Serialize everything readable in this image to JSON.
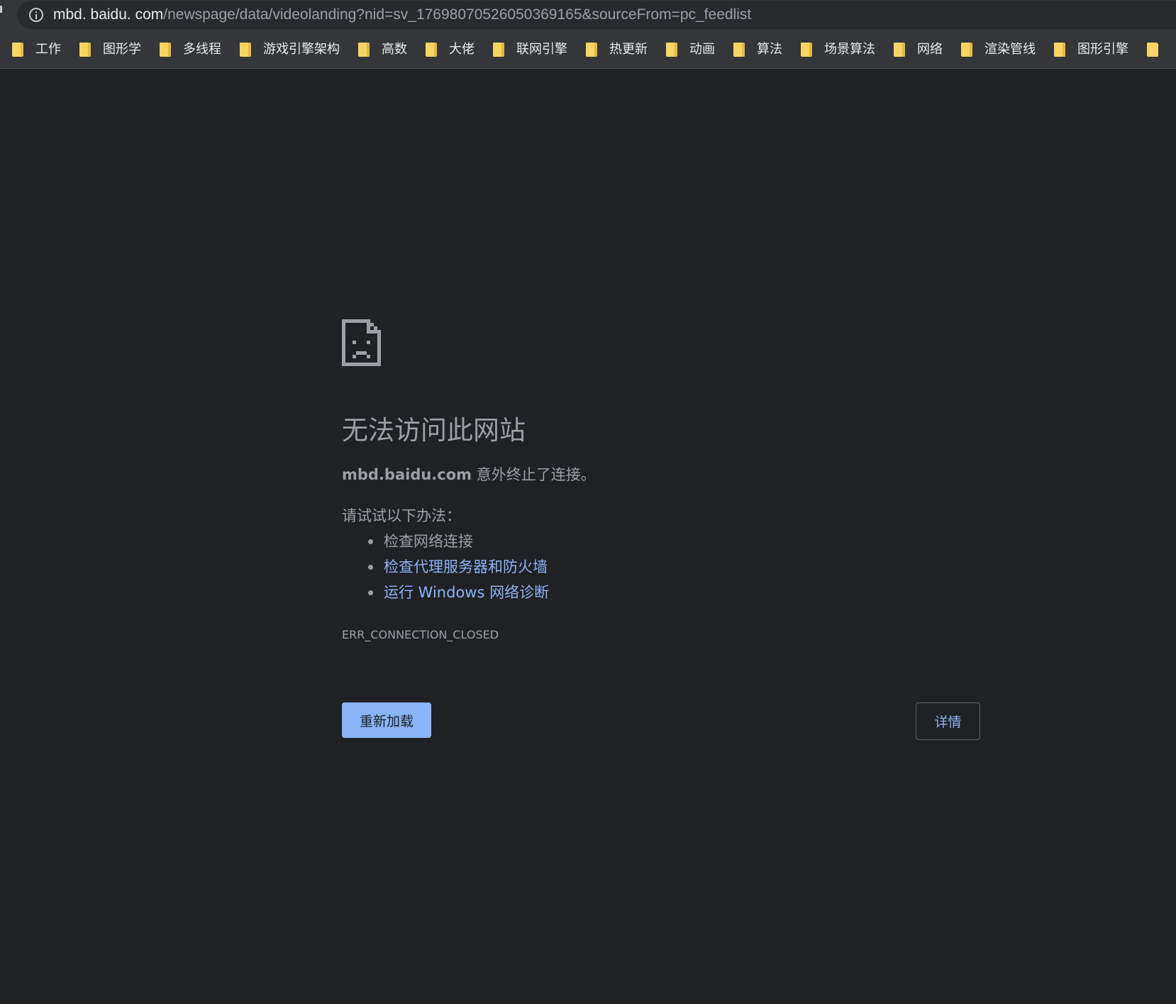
{
  "browser": {
    "url_host": "mbd. baidu. com",
    "url_rest": "/newspage/data/videolanding?nid=sv_17698070526050369165&sourceFrom=pc_feedlist",
    "info_icon": "info-icon"
  },
  "bookmarks": [
    {
      "label": "工作",
      "icon": "folder-icon"
    },
    {
      "label": "图形学",
      "icon": "folder-icon"
    },
    {
      "label": "多线程",
      "icon": "folder-icon"
    },
    {
      "label": "游戏引擎架构",
      "icon": "folder-icon"
    },
    {
      "label": "高数",
      "icon": "folder-icon"
    },
    {
      "label": "大佬",
      "icon": "folder-icon"
    },
    {
      "label": "联网引擎",
      "icon": "folder-icon"
    },
    {
      "label": "热更新",
      "icon": "folder-icon"
    },
    {
      "label": "动画",
      "icon": "folder-icon"
    },
    {
      "label": "算法",
      "icon": "folder-icon"
    },
    {
      "label": "场景算法",
      "icon": "folder-icon"
    },
    {
      "label": "网络",
      "icon": "folder-icon"
    },
    {
      "label": "渲染管线",
      "icon": "folder-icon"
    },
    {
      "label": "图形引擎",
      "icon": "folder-icon"
    }
  ],
  "error": {
    "icon": "sad-page-icon",
    "title": "无法访问此网站",
    "host": "mbd.baidu.com",
    "message": " 意外终止了连接。",
    "suggestions_heading": "请试试以下办法：",
    "suggestions": [
      {
        "text": "检查网络连接",
        "is_link": false
      },
      {
        "text": "检查代理服务器和防火墙",
        "is_link": true
      },
      {
        "text": "运行 Windows 网络诊断",
        "is_link": true
      }
    ],
    "code": "ERR_CONNECTION_CLOSED",
    "reload_label": "重新加载",
    "details_label": "详情"
  },
  "colors": {
    "background": "#202124",
    "chrome_bar": "#35363a",
    "text": "#9aa0a6",
    "link": "#8ab4f8",
    "folder": "#f6d565"
  }
}
